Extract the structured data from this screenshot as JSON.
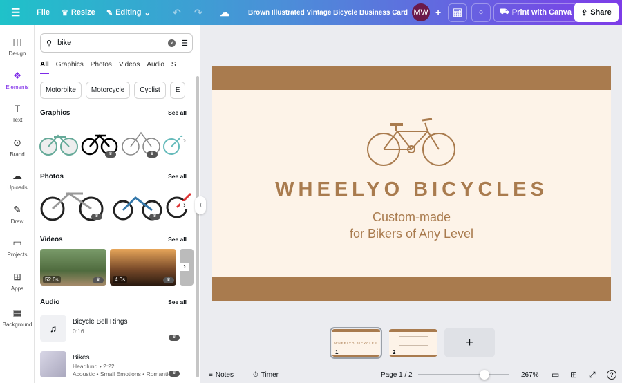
{
  "topbar": {
    "file": "File",
    "resize": "Resize",
    "editing": "Editing",
    "title": "Brown Illustrated Vintage Bicycle Business Card",
    "avatar": "MW",
    "print": "Print with Canva",
    "share": "Share"
  },
  "rail": [
    {
      "label": "Design",
      "icon": "layout-icon"
    },
    {
      "label": "Elements",
      "icon": "elements-icon",
      "active": true
    },
    {
      "label": "Text",
      "icon": "text-icon"
    },
    {
      "label": "Brand",
      "icon": "brand-icon"
    },
    {
      "label": "Uploads",
      "icon": "upload-icon"
    },
    {
      "label": "Draw",
      "icon": "draw-icon"
    },
    {
      "label": "Projects",
      "icon": "folder-icon"
    },
    {
      "label": "Apps",
      "icon": "apps-icon"
    },
    {
      "label": "Background",
      "icon": "background-icon"
    }
  ],
  "panel": {
    "search": {
      "value": "bike"
    },
    "tabs": [
      "All",
      "Graphics",
      "Photos",
      "Videos",
      "Audio",
      "S"
    ],
    "chips": [
      "Motorbike",
      "Motorcycle",
      "Cyclist",
      "E"
    ],
    "sections": {
      "graphics": "Graphics",
      "photos": "Photos",
      "videos": "Videos",
      "audio": "Audio",
      "see_all": "See all"
    },
    "videos": [
      {
        "duration": "52.0s"
      },
      {
        "duration": "4.0s"
      }
    ],
    "audio": [
      {
        "title": "Bicycle Bell Rings",
        "meta": "0:16"
      },
      {
        "title": "Bikes",
        "meta": "Headlund • 2:22",
        "tags": "Acoustic • Small Emotions • Romantic"
      }
    ]
  },
  "design": {
    "brand": "WHEELYO BICYCLES",
    "line1": "Custom-made",
    "line2": "for Bikers of Any Level",
    "colors": {
      "brown": "#a97b4e",
      "cream": "#fdf3e8"
    }
  },
  "pages": [
    {
      "num": "1"
    },
    {
      "num": "2"
    }
  ],
  "add_page": "+",
  "bottom": {
    "notes": "Notes",
    "timer": "Timer",
    "page": "Page 1 / 2",
    "zoom": "267%",
    "zoom_fraction": 0.73
  }
}
